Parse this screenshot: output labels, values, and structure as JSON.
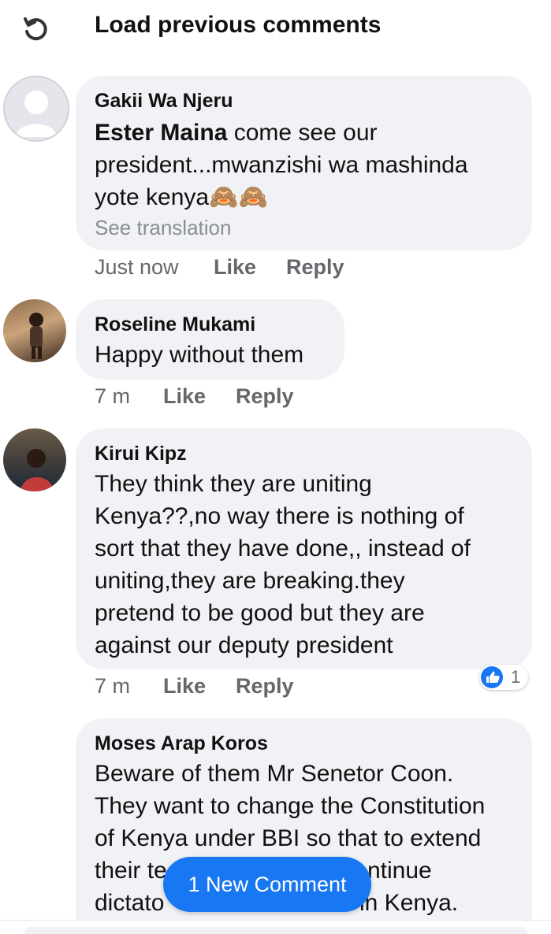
{
  "header": {
    "load_previous_label": "Load previous comments",
    "refresh_icon": "refresh-icon"
  },
  "comments": [
    {
      "author": "Gakii Wa Njeru",
      "mention": "Ester Maina",
      "text_after_mention": " come see our\npresident...mwanzishi wa mashinda\nyote kenya🙈🙈",
      "see_translation": "See translation",
      "time": "Just now",
      "like_label": "Like",
      "reply_label": "Reply",
      "avatar": "default-profile"
    },
    {
      "author": "Roseline Mukami",
      "text": "Happy without them",
      "time": "7 m",
      "like_label": "Like",
      "reply_label": "Reply",
      "avatar": "profile-photo"
    },
    {
      "author": "Kirui Kipz",
      "text": "They think they are uniting\nKenya??,no way there is nothing of\nsort that they have done,, instead of\nuniting,they are breaking.they\npretend to be good but they are\nagainst our deputy president",
      "time": "7 m",
      "like_label": "Like",
      "reply_label": "Reply",
      "reaction_count": "1",
      "reaction_icon": "like-icon",
      "avatar": "profile-photo"
    },
    {
      "author": "Moses Arap Koros",
      "text_visible": "Beware of  them Mr Senetor Coon.\nThey want to change the Constitution\nof Kenya under BBI so that to extend",
      "text_line4_left": "their te",
      "text_line4_right": "ntinue",
      "text_line5_left": "dictato",
      "text_line5_right": "in Kenya.",
      "avatar": "profile-photo"
    }
  ],
  "new_comment_pill": "1 New Comment",
  "colors": {
    "accent": "#1877f2",
    "bubble": "#f0f2f5",
    "meta_text": "#65676b",
    "translation_text": "#8a8d91"
  }
}
